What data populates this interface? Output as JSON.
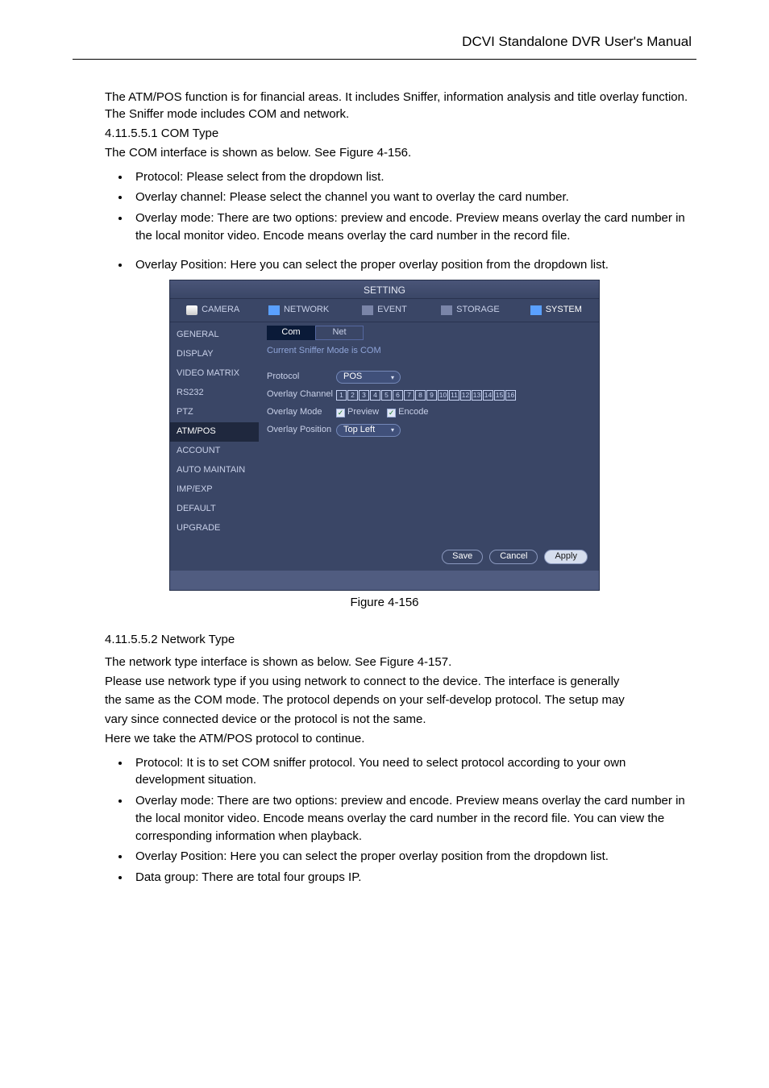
{
  "header": {
    "title": "DCVI Standalone DVR User's Manual"
  },
  "body": {
    "intro1": "The ATM/POS function is for financial areas. It includes Sniffer, information analysis and title overlay function. The Sniffer mode includes COM and network.",
    "intro2": "4.11.5.5.1 COM Type",
    "intro3": "The COM interface is shown as below. See Figure 4-156.",
    "comBullets": [
      "Protocol: Please select from the dropdown list.",
      "Overlay channel: Please select the channel you want to overlay the card number.",
      "Overlay mode: There are two options: preview and encode. Preview means overlay the card number in the local monitor video. Encode means overlay the card number in the record file."
    ],
    "comBullets2": [
      "Overlay Position: Here you can select the proper overlay position from the dropdown list."
    ],
    "figcap": "Figure 4-156",
    "netHeading": "4.11.5.5.2 Network Type",
    "netIntro1": "The network type interface is shown as below. See Figure 4-157.",
    "netIntro2": "Please use network type if you using network to connect to the device. The interface is generally",
    "netIntro3": "the same as the COM mode. The protocol depends on your self-develop protocol. The setup may",
    "netIntro4": "vary since connected device or the protocol is not the same.",
    "netIntro5": "Here we take the ATM/POS protocol to continue.",
    "netBullets": [
      "Protocol: It is to set COM sniffer protocol. You need to select protocol according to your own development situation.",
      "Overlay mode: There are two options: preview and encode. Preview means overlay the card number in the local monitor video. Encode means overlay the card number in the record file. You can view the corresponding information when playback.",
      "Overlay Position: Here you can select the proper overlay position from the dropdown list.",
      "Data group: There are total four groups IP."
    ]
  },
  "shot": {
    "title": "SETTING",
    "tabs": [
      "CAMERA",
      "NETWORK",
      "EVENT",
      "STORAGE",
      "SYSTEM"
    ],
    "sidebar": [
      "GENERAL",
      "DISPLAY",
      "VIDEO MATRIX",
      "RS232",
      "PTZ",
      "ATM/POS",
      "ACCOUNT",
      "AUTO MAINTAIN",
      "IMP/EXP",
      "DEFAULT",
      "UPGRADE"
    ],
    "subtabs": [
      "Com",
      "Net"
    ],
    "snifferLine": "Current Sniffer Mode is COM",
    "labels": {
      "protocol": "Protocol",
      "overlayChannel": "Overlay Channel",
      "overlayMode": "Overlay Mode",
      "overlayPosition": "Overlay Position"
    },
    "values": {
      "protocol": "POS",
      "preview": "Preview",
      "encode": "Encode",
      "overlayPosition": "Top Left"
    },
    "channels": [
      "1",
      "2",
      "3",
      "4",
      "5",
      "6",
      "7",
      "8",
      "9",
      "10",
      "11",
      "12",
      "13",
      "14",
      "15",
      "16"
    ],
    "buttons": [
      "Save",
      "Cancel",
      "Apply"
    ]
  }
}
